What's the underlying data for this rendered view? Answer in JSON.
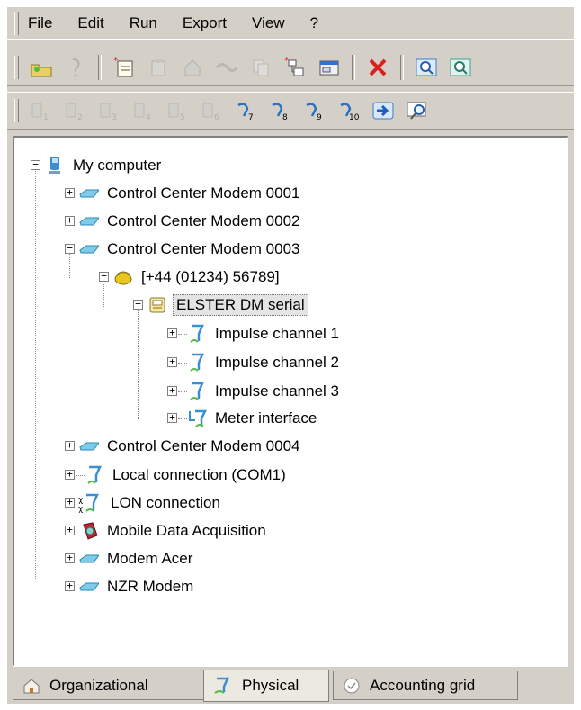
{
  "menu": [
    "File",
    "Edit",
    "Run",
    "Export",
    "View",
    "?"
  ],
  "toolbar1_icons": [
    "open-folder-icon",
    "wizard-icon",
    "new-item-icon",
    "paste-icon",
    "home-icon",
    "connect-icon",
    "copy-icon",
    "new-subitem-icon",
    "properties-icon",
    "delete-icon",
    "zoom-icon",
    "zoom-fit-icon"
  ],
  "toolbar2_icons": [
    "action-1-icon",
    "action-2-icon",
    "action-3-icon",
    "action-4-icon",
    "action-5-icon",
    "action-6-icon",
    "action-7-icon",
    "action-8-icon",
    "action-9-icon",
    "action-10-icon",
    "arrow-right-icon",
    "search-icon"
  ],
  "tree": {
    "root": "My computer",
    "modem1": "Control Center Modem 0001",
    "modem2": "Control Center Modem 0002",
    "modem3": "Control Center Modem 0003",
    "phone": "[+44 (01234) 56789]",
    "device": "ELSTER DM serial",
    "ch1": "Impulse channel 1",
    "ch2": "Impulse channel 2",
    "ch3": "Impulse channel 3",
    "meter": "Meter interface",
    "modem4": "Control Center Modem 0004",
    "local": "Local connection (COM1)",
    "lon": "LON connection",
    "mobile": "Mobile Data Acquisition",
    "acer": "Modem Acer",
    "nzr": "NZR Modem"
  },
  "tabs": {
    "organizational": "Organizational",
    "physical": "Physical",
    "accounting": "Accounting grid"
  },
  "colors": {
    "modem_icon": "#4fb3d8",
    "meter_icon": "#3a8fd0",
    "selected_bg": "#e4e4e4"
  }
}
